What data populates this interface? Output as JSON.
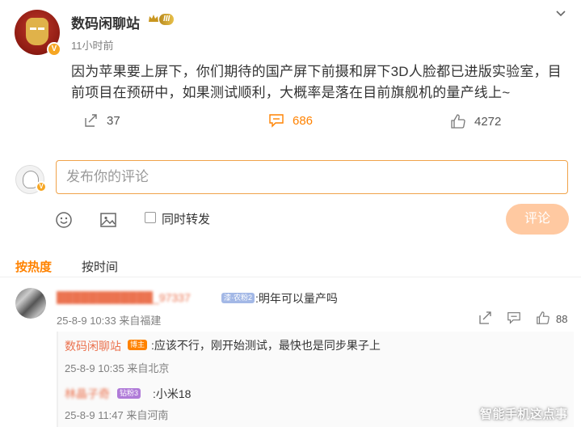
{
  "post": {
    "author": "数码闲聊站",
    "level_badge": "III",
    "time": "11小时前",
    "text": "因为苹果要上屏下，你们期待的国产屏下前摄和屏下3D人脸都已进版实验室，目前项目在预研中，如果测试顺利，大概率是落在目前旗舰机的量产线上~",
    "shares": "37",
    "comments": "686",
    "likes": "4272"
  },
  "composer": {
    "placeholder": "发布你的评论",
    "repost_label": "同时转发",
    "submit_label": "评论"
  },
  "sort_tabs": {
    "hot": "按热度",
    "time": "按时间"
  },
  "comments": [
    {
      "name": "████████████_97337",
      "badge": "漆·农粉2",
      "text": ":明年可以量产吗",
      "meta": "25-8-9 10:33 来自福建",
      "likes": "88",
      "replies": [
        {
          "name": "数码闲聊站",
          "badge": "博主",
          "text": ":应该不行，刚开始测试，最快也是同步果子上",
          "meta": "25-8-9 10:35 来自北京"
        },
        {
          "name": "林晶子奇",
          "badge": "钻粉3",
          "text": ":小米18",
          "meta": "25-8-9 11:47 来自河南"
        }
      ]
    }
  ],
  "watermark": "智能手机这点事",
  "colors": {
    "accent": "#ff8200",
    "name": "#eb7350",
    "muted": "#808080",
    "submit_disabled": "#ffc9a1"
  },
  "icons": {
    "expand": "chevron-down-icon",
    "share": "share-icon",
    "comment": "comment-icon",
    "like": "thumb-up-icon",
    "emoji": "emoji-icon",
    "image": "image-icon",
    "crown": "crown-icon",
    "verified": "verified-icon"
  }
}
